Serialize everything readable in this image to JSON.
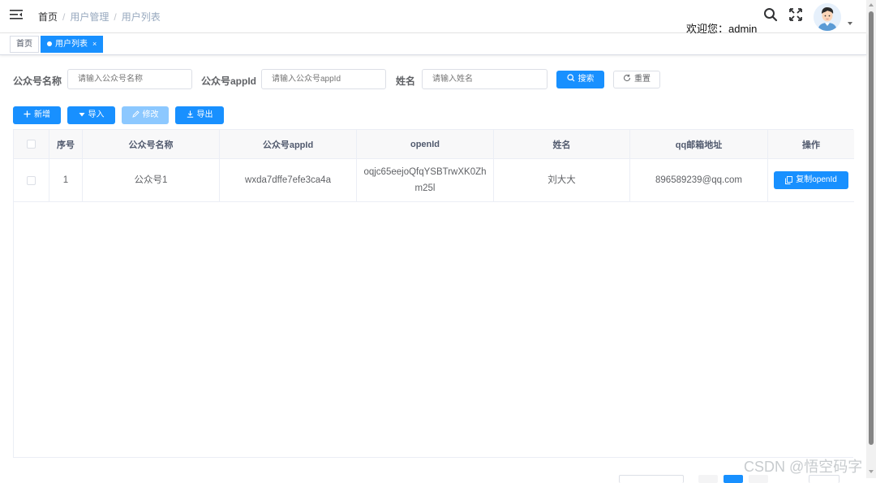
{
  "navbar": {
    "breadcrumb": [
      "首页",
      "用户管理",
      "用户列表"
    ],
    "separator": "/",
    "welcome": "欢迎您：admin",
    "icons": [
      "hamburger-icon",
      "search-icon",
      "fullscreen-icon",
      "avatar",
      "caret-down-icon"
    ]
  },
  "tags": [
    {
      "label": "首页",
      "active": false
    },
    {
      "label": "用户列表",
      "active": true,
      "close": "×"
    }
  ],
  "search_form": {
    "fields": [
      {
        "label": "公众号名称",
        "placeholder": "请输入公众号名称"
      },
      {
        "label": "公众号appId",
        "placeholder": "请输入公众号appId"
      },
      {
        "label": "姓名",
        "placeholder": "请输入姓名"
      }
    ],
    "search_button": "搜索",
    "reset_button": "重置"
  },
  "toolbar": {
    "add": "新增",
    "import": "导入",
    "edit": "修改",
    "export": "导出"
  },
  "table": {
    "columns": [
      "",
      "序号",
      "公众号名称",
      "公众号appId",
      "openId",
      "姓名",
      "qq邮箱地址",
      "操作"
    ],
    "rows": [
      {
        "index": "1",
        "name": "公众号1",
        "appId": "wxda7dffe7efe3ca4a",
        "openId": "oqjc65eejoQfqYSBTrwXK0Zhm25l",
        "realName": "刘大大",
        "email": "896589239@qq.com",
        "action": "复制openId"
      }
    ]
  },
  "watermark": "CSDN @悟空码字",
  "colors": {
    "primary": "#1890ff",
    "disabled": "#8cc8ff",
    "header_bg": "#f8f8f9",
    "border": "#ebeef5"
  }
}
